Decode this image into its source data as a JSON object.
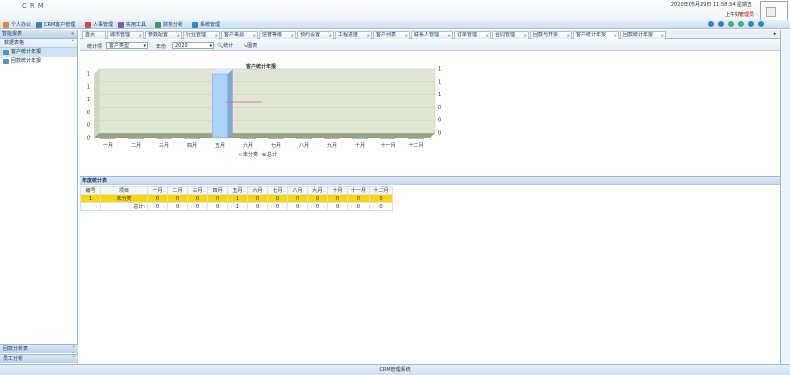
{
  "header": {
    "logo": "CRM",
    "datetime": "2020年05月29日 11:58:34 星期五",
    "user_label": "上午好!",
    "user_name": "管理员"
  },
  "menu": [
    {
      "label": "个人办公",
      "icon": "person-icon",
      "color": "#e38a2e"
    },
    {
      "label": "CRM客户管理",
      "icon": "customers-icon",
      "color": "#3c7fc4"
    },
    {
      "label": "人事管理",
      "icon": "hr-icon",
      "color": "#d24a3b"
    },
    {
      "label": "实用工具",
      "icon": "tools-icon",
      "color": "#7a5db8"
    },
    {
      "label": "财务分析",
      "icon": "finance-icon",
      "color": "#3b9d5d"
    },
    {
      "label": "系统管理",
      "icon": "settings-icon",
      "color": "#2e8bc9"
    }
  ],
  "sidebar": {
    "section": "智能报表",
    "subsection": "数据表格",
    "items": [
      "客户统计年报",
      "回款统计年报"
    ],
    "bottom": [
      "回款分析表",
      "员工分析"
    ]
  },
  "tabs": [
    "首页",
    "城市管理",
    "参数配置",
    "行业管理",
    "客户来源",
    "信誉等级",
    "预约设置",
    "工程进度",
    "客户列表",
    "联系人管理",
    "订单管理",
    "合同管理",
    "回款与开票",
    "客户统计年报",
    "回款统计年报"
  ],
  "filter": {
    "type_label": "统计项",
    "type_value": "客户类型",
    "year_label": "年份",
    "year_value": "2020",
    "stat_button": "统计",
    "chart_button": "图表"
  },
  "chart_data": {
    "type": "bar",
    "title": "客户统计年报",
    "categories": [
      "一月",
      "二月",
      "三月",
      "四月",
      "五月",
      "六月",
      "七月",
      "八月",
      "九月",
      "十月",
      "十一月",
      "十二月"
    ],
    "series": [
      {
        "name": "未分类",
        "values": [
          0,
          0,
          0,
          0,
          1,
          0,
          0,
          0,
          0,
          0,
          0,
          0
        ],
        "color": "#aad4f5"
      },
      {
        "name": "总计",
        "values": [
          0,
          0,
          0,
          0,
          1,
          0,
          0,
          0,
          0,
          0,
          0,
          0
        ],
        "color": "#e75aa8"
      }
    ],
    "ylim": [
      0,
      1
    ],
    "y_ticks": [
      "0",
      "0",
      "0",
      "1",
      "1",
      "1"
    ],
    "grid": true
  },
  "table": {
    "title": "年度统计表",
    "headers": [
      "编号",
      "项目",
      "一月",
      "二月",
      "三月",
      "四月",
      "五月",
      "六月",
      "七月",
      "八月",
      "九月",
      "十月",
      "十一月",
      "十二月"
    ],
    "rows": [
      [
        "1",
        "未分类",
        "0",
        "0",
        "0",
        "0",
        "1",
        "0",
        "0",
        "0",
        "0",
        "0",
        "0",
        "0"
      ],
      [
        "",
        "总计:",
        "0",
        "0",
        "0",
        "0",
        "1",
        "0",
        "0",
        "0",
        "0",
        "0",
        "0",
        "0"
      ]
    ]
  },
  "status": "CRM管理系统"
}
